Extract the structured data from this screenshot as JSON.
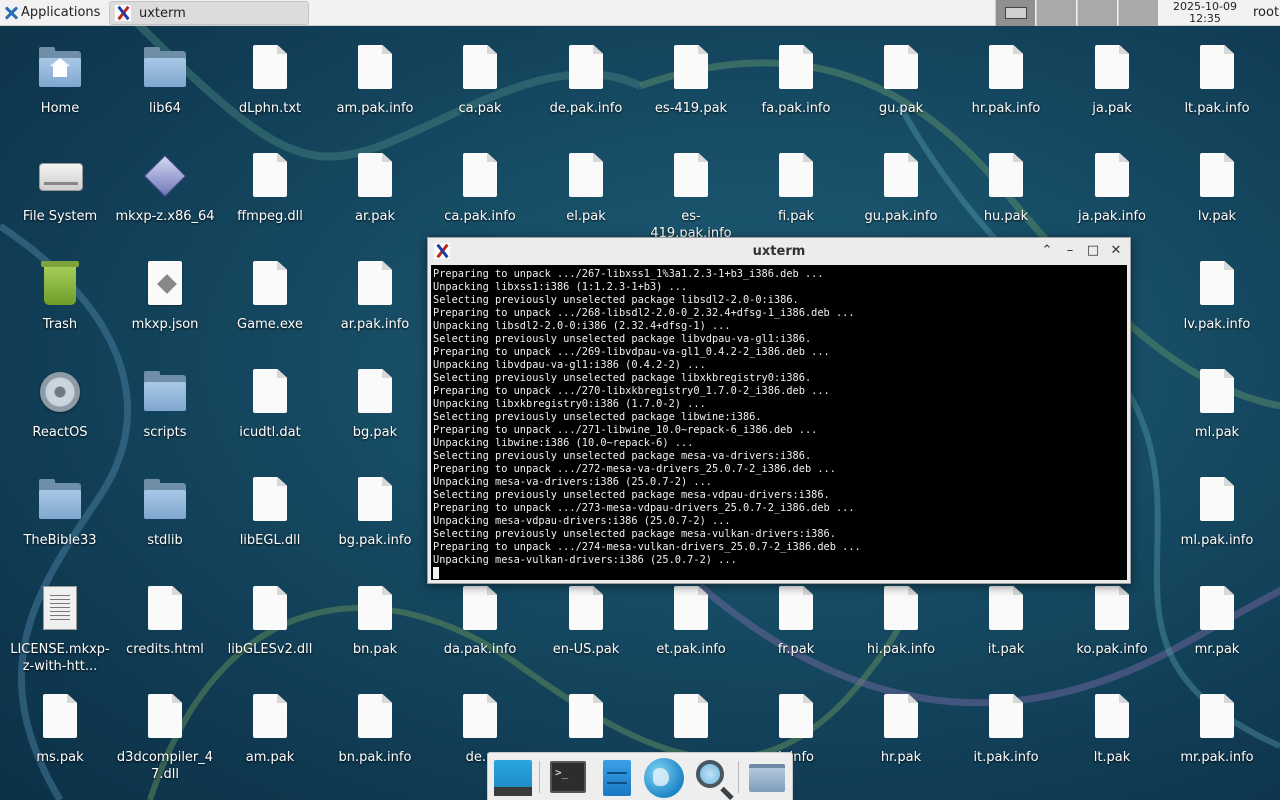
{
  "top_panel": {
    "applications_label": "Applications",
    "task_title": "uxterm",
    "clock_date": "2025-10-09",
    "clock_time": "12:35",
    "user": "root"
  },
  "desktop_icons": [
    {
      "label": "Home",
      "icon": "home-folder-icon"
    },
    {
      "label": "lib64",
      "icon": "folder-icon"
    },
    {
      "label": "dLphn.txt",
      "icon": "file-icon"
    },
    {
      "label": "am.pak.info",
      "icon": "file-icon"
    },
    {
      "label": "ca.pak",
      "icon": "file-icon"
    },
    {
      "label": "de.pak.info",
      "icon": "file-icon"
    },
    {
      "label": "es-419.pak",
      "icon": "file-icon"
    },
    {
      "label": "fa.pak.info",
      "icon": "file-icon"
    },
    {
      "label": "gu.pak",
      "icon": "file-icon"
    },
    {
      "label": "hr.pak.info",
      "icon": "file-icon"
    },
    {
      "label": "ja.pak",
      "icon": "file-icon"
    },
    {
      "label": "lt.pak.info",
      "icon": "file-icon"
    },
    {
      "label": "File System",
      "icon": "drive-icon"
    },
    {
      "label": "mkxp-z.x86_64",
      "icon": "executable-icon"
    },
    {
      "label": "ffmpeg.dll",
      "icon": "file-icon"
    },
    {
      "label": "ar.pak",
      "icon": "file-icon"
    },
    {
      "label": "ca.pak.info",
      "icon": "file-icon"
    },
    {
      "label": "el.pak",
      "icon": "file-icon"
    },
    {
      "label": "es-419.pak.info",
      "icon": "file-icon"
    },
    {
      "label": "fi.pak",
      "icon": "file-icon"
    },
    {
      "label": "gu.pak.info",
      "icon": "file-icon"
    },
    {
      "label": "hu.pak",
      "icon": "file-icon"
    },
    {
      "label": "ja.pak.info",
      "icon": "file-icon"
    },
    {
      "label": "lv.pak",
      "icon": "file-icon"
    },
    {
      "label": "Trash",
      "icon": "trash-icon"
    },
    {
      "label": "mkxp.json",
      "icon": "json-file-icon"
    },
    {
      "label": "Game.exe",
      "icon": "file-icon"
    },
    {
      "label": "ar.pak.info",
      "icon": "file-icon"
    },
    {
      "label": "lv.pak.info",
      "icon": "file-icon"
    },
    {
      "label": "ReactOS",
      "icon": "disc-icon"
    },
    {
      "label": "scripts",
      "icon": "folder-icon"
    },
    {
      "label": "icudtl.dat",
      "icon": "file-icon"
    },
    {
      "label": "bg.pak",
      "icon": "file-icon"
    },
    {
      "label": "ml.pak",
      "icon": "file-icon"
    },
    {
      "label": "TheBible33",
      "icon": "folder-icon"
    },
    {
      "label": "stdlib",
      "icon": "folder-icon"
    },
    {
      "label": "libEGL.dll",
      "icon": "file-icon"
    },
    {
      "label": "bg.pak.info",
      "icon": "file-icon"
    },
    {
      "label": "ml.pak.info",
      "icon": "file-icon"
    },
    {
      "label": "LICENSE.mkxp-z-with-htt...",
      "icon": "document-icon"
    },
    {
      "label": "credits.html",
      "icon": "file-icon"
    },
    {
      "label": "libGLESv2.dll",
      "icon": "file-icon"
    },
    {
      "label": "bn.pak",
      "icon": "file-icon"
    },
    {
      "label": "da.pak.info",
      "icon": "file-icon"
    },
    {
      "label": "en-US.pak",
      "icon": "file-icon"
    },
    {
      "label": "et.pak.info",
      "icon": "file-icon"
    },
    {
      "label": "fr.pak",
      "icon": "file-icon"
    },
    {
      "label": "hi.pak.info",
      "icon": "file-icon"
    },
    {
      "label": "it.pak",
      "icon": "file-icon"
    },
    {
      "label": "ko.pak.info",
      "icon": "file-icon"
    },
    {
      "label": "mr.pak",
      "icon": "file-icon"
    },
    {
      "label": "ms.pak",
      "icon": "file-icon"
    },
    {
      "label": "d3dcompiler_47.dll",
      "icon": "file-icon"
    },
    {
      "label": "am.pak",
      "icon": "file-icon"
    },
    {
      "label": "bn.pak.info",
      "icon": "file-icon"
    },
    {
      "label": "de.p",
      "icon": "file-icon"
    },
    {
      "label": "",
      "icon": "file-icon"
    },
    {
      "label": "",
      "icon": "file-icon"
    },
    {
      "label": "k.info",
      "icon": "file-icon"
    },
    {
      "label": "hr.pak",
      "icon": "file-icon"
    },
    {
      "label": "it.pak.info",
      "icon": "file-icon"
    },
    {
      "label": "lt.pak",
      "icon": "file-icon"
    },
    {
      "label": "mr.pak.info",
      "icon": "file-icon"
    },
    {
      "label": "nfo",
      "icon": "file-icon"
    }
  ],
  "terminal": {
    "title": "uxterm",
    "lines": [
      "Preparing to unpack .../267-libxss1_1%3a1.2.3-1+b3_i386.deb ...",
      "Unpacking libxss1:i386 (1:1.2.3-1+b3) ...",
      "Selecting previously unselected package libsdl2-2.0-0:i386.",
      "Preparing to unpack .../268-libsdl2-2.0-0_2.32.4+dfsg-1_i386.deb ...",
      "Unpacking libsdl2-2.0-0:i386 (2.32.4+dfsg-1) ...",
      "Selecting previously unselected package libvdpau-va-gl1:i386.",
      "Preparing to unpack .../269-libvdpau-va-gl1_0.4.2-2_i386.deb ...",
      "Unpacking libvdpau-va-gl1:i386 (0.4.2-2) ...",
      "Selecting previously unselected package libxkbregistry0:i386.",
      "Preparing to unpack .../270-libxkbregistry0_1.7.0-2_i386.deb ...",
      "Unpacking libxkbregistry0:i386 (1.7.0-2) ...",
      "Selecting previously unselected package libwine:i386.",
      "Preparing to unpack .../271-libwine_10.0~repack-6_i386.deb ...",
      "Unpacking libwine:i386 (10.0~repack-6) ...",
      "Selecting previously unselected package mesa-va-drivers:i386.",
      "Preparing to unpack .../272-mesa-va-drivers_25.0.7-2_i386.deb ...",
      "Unpacking mesa-va-drivers:i386 (25.0.7-2) ...",
      "Selecting previously unselected package mesa-vdpau-drivers:i386.",
      "Preparing to unpack .../273-mesa-vdpau-drivers_25.0.7-2_i386.deb ...",
      "Unpacking mesa-vdpau-drivers:i386 (25.0.7-2) ...",
      "Selecting previously unselected package mesa-vulkan-drivers:i386.",
      "Preparing to unpack .../274-mesa-vulkan-drivers_25.0.7-2_i386.deb ...",
      "Unpacking mesa-vulkan-drivers:i386 (25.0.7-2) ..."
    ]
  },
  "dock": {
    "items": [
      {
        "icon": "show-desktop-icon"
      },
      {
        "icon": "terminal-icon"
      },
      {
        "icon": "file-manager-icon"
      },
      {
        "icon": "web-browser-icon"
      },
      {
        "icon": "search-icon"
      },
      {
        "icon": "folder-icon"
      }
    ]
  },
  "colors": {
    "desktop_bg": "#164b63",
    "terminal_bg": "#000000",
    "terminal_fg": "#f0f0f0",
    "panel_bg": "#f2f2f2"
  }
}
